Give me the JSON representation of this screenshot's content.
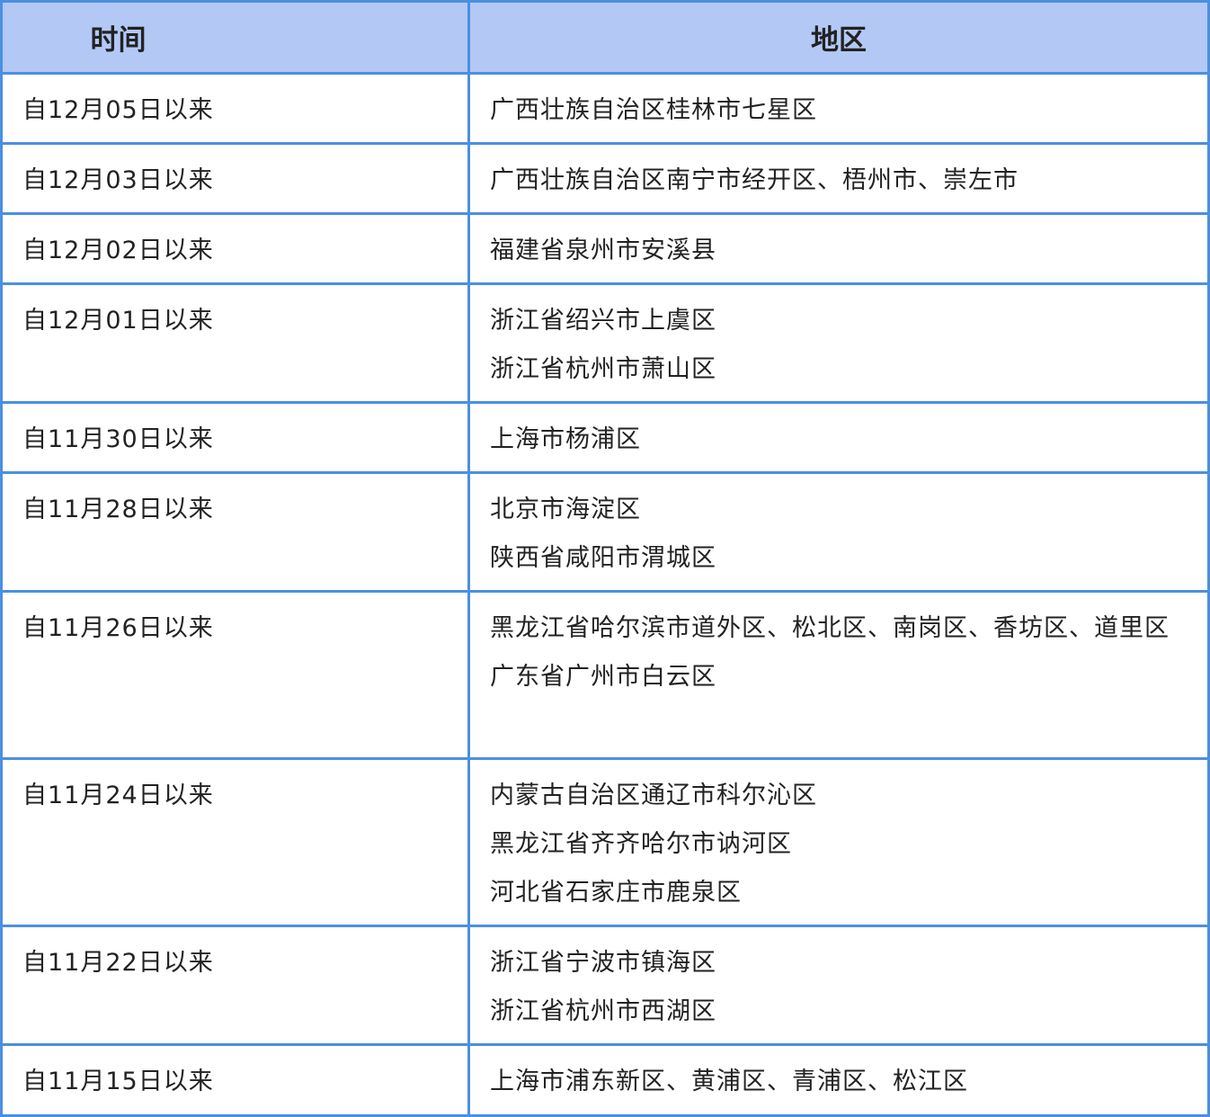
{
  "header": {
    "time_label": "时间",
    "region_label": "地区"
  },
  "colors": {
    "border": "#4a90e2",
    "header_bg": "#b3c8f5"
  },
  "rows": [
    {
      "time": "自12月05日以来",
      "regions": [
        "广西壮族自治区桂林市七星区"
      ]
    },
    {
      "time": "自12月03日以来",
      "regions": [
        "广西壮族自治区南宁市经开区、梧州市、崇左市"
      ]
    },
    {
      "time": "自12月02日以来",
      "regions": [
        "福建省泉州市安溪县"
      ]
    },
    {
      "time": "自12月01日以来",
      "regions": [
        "浙江省绍兴市上虞区",
        "浙江省杭州市萧山区"
      ]
    },
    {
      "time": "自11月30日以来",
      "regions": [
        "上海市杨浦区"
      ]
    },
    {
      "time": "自11月28日以来",
      "regions": [
        "北京市海淀区",
        "陕西省咸阳市渭城区"
      ]
    },
    {
      "time": "自11月26日以来",
      "regions": [
        "黑龙江省哈尔滨市道外区、松北区、南岗区、香坊区、道里区",
        "广东省广州市白云区"
      ]
    },
    {
      "time": "自11月24日以来",
      "regions": [
        "内蒙古自治区通辽市科尔沁区",
        "黑龙江省齐齐哈尔市讷河区",
        "河北省石家庄市鹿泉区"
      ]
    },
    {
      "time": "自11月22日以来",
      "regions": [
        "浙江省宁波市镇海区",
        "浙江省杭州市西湖区"
      ]
    },
    {
      "time": "自11月15日以来",
      "regions": [
        "上海市浦东新区、黄浦区、青浦区、松江区"
      ]
    }
  ]
}
